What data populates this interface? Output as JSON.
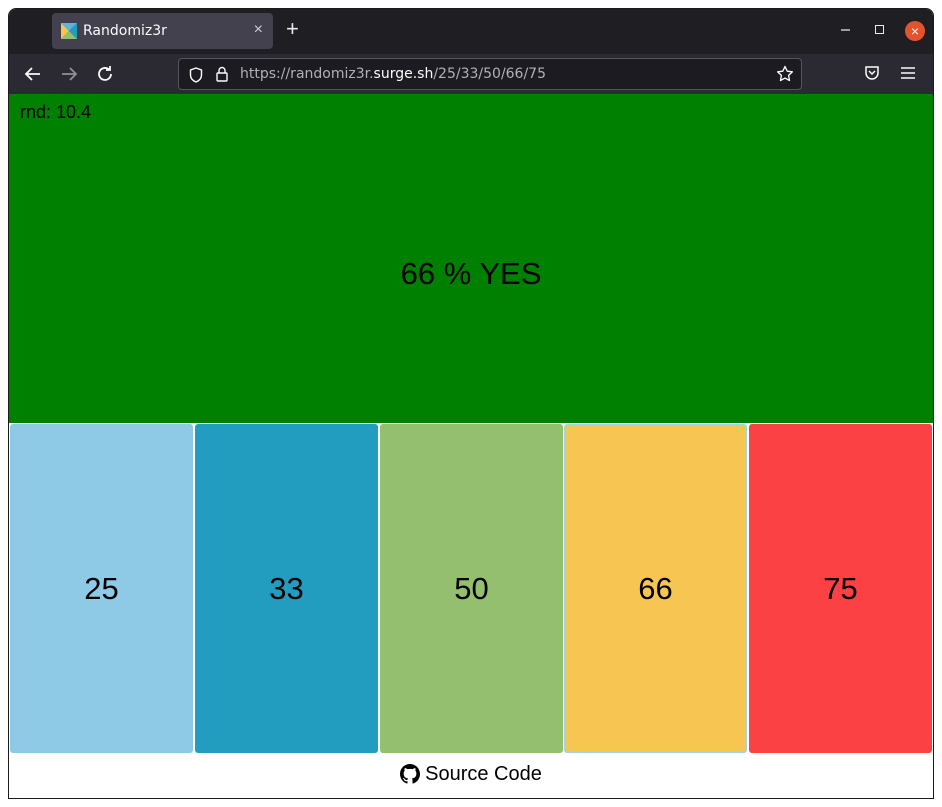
{
  "browser": {
    "tab_title": "Randomiz3r",
    "tab_close": "×",
    "new_tab": "+",
    "window_close": "×",
    "url_prefix": "https://randomiz3r.",
    "url_host": "surge.sh",
    "url_path": "/25/33/50/66/75"
  },
  "page": {
    "rnd_label": "rnd: 10.4",
    "result_text": "66 % YES",
    "result_color": "#008000",
    "options": [
      {
        "label": "25",
        "color": "#8ec9e6",
        "selected": false
      },
      {
        "label": "33",
        "color": "#229dbf",
        "selected": false
      },
      {
        "label": "50",
        "color": "#93bf6e",
        "selected": false
      },
      {
        "label": "66",
        "color": "#f7c552",
        "selected": true
      },
      {
        "label": "75",
        "color": "#fc4144",
        "selected": false
      }
    ],
    "source_code": "Source Code"
  }
}
